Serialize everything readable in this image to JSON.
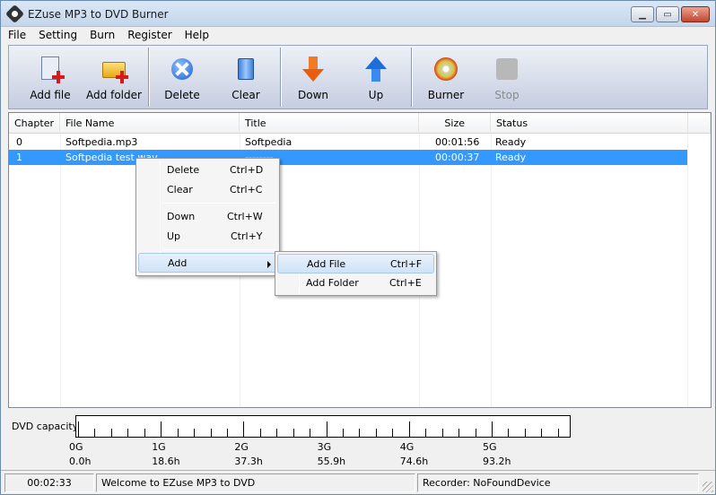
{
  "window": {
    "title": "EZuse MP3 to DVD Burner"
  },
  "menu": [
    "File",
    "Setting",
    "Burn",
    "Register",
    "Help"
  ],
  "toolbar": {
    "add_file": "Add file",
    "add_folder": "Add folder",
    "delete": "Delete",
    "clear": "Clear",
    "down": "Down",
    "up": "Up",
    "burner": "Burner",
    "stop": "Stop"
  },
  "list": {
    "columns": [
      "Chapter",
      "File Name",
      "Title",
      "Size",
      "Status"
    ],
    "rows": [
      {
        "chapter": "0",
        "file": "Softpedia.mp3",
        "title": "Softpedia",
        "size": "00:01:56",
        "status": "Ready",
        "selected": false
      },
      {
        "chapter": "1",
        "file": "Softpedia test.wav",
        "title": "--------",
        "size": "00:00:37",
        "status": "Ready",
        "selected": true
      }
    ]
  },
  "context_menu": {
    "items": [
      {
        "label": "Delete",
        "shortcut": "Ctrl+D"
      },
      {
        "label": "Clear",
        "shortcut": "Ctrl+C"
      },
      {
        "label": "Down",
        "shortcut": "Ctrl+W"
      },
      {
        "label": "Up",
        "shortcut": "Ctrl+Y"
      },
      {
        "label": "Add",
        "shortcut": ""
      }
    ]
  },
  "submenu": {
    "items": [
      {
        "label": "Add File",
        "shortcut": "Ctrl+F"
      },
      {
        "label": "Add Folder",
        "shortcut": "Ctrl+E"
      }
    ]
  },
  "capacity": {
    "label": "DVD capacity:",
    "gb_labels": [
      "0G",
      "1G",
      "2G",
      "3G",
      "4G",
      "5G"
    ],
    "hour_labels": [
      "0.0h",
      "18.6h",
      "37.3h",
      "55.9h",
      "74.6h",
      "93.2h"
    ]
  },
  "status": {
    "time": "00:02:33",
    "message": "Welcome to EZuse MP3 to DVD",
    "recorder": "Recorder: NoFoundDevice"
  },
  "colors": {
    "selection": "#3399ff",
    "toolbar_bg": "#c5cde0"
  }
}
